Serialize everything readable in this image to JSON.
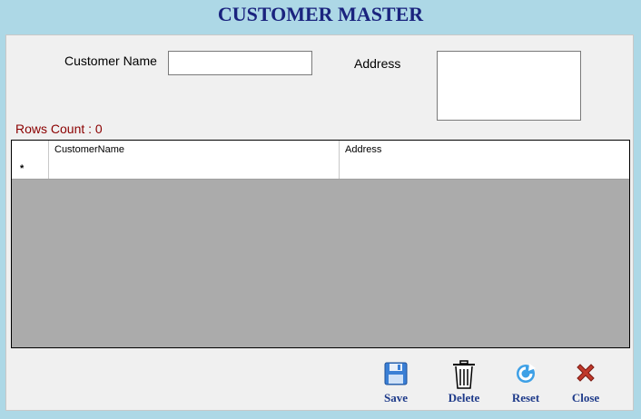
{
  "window": {
    "title": "CUSTOMER MASTER"
  },
  "form": {
    "customer_name_label": "Customer Name",
    "customer_name_value": "",
    "address_label": "Address",
    "address_value": "",
    "rows_count_text": "Rows Count : 0"
  },
  "grid": {
    "columns": [
      "CustomerName",
      "Address"
    ],
    "new_row_marker": "*",
    "rows": []
  },
  "toolbar": {
    "save_label": "Save",
    "delete_label": "Delete",
    "reset_label": "Reset",
    "close_label": "Close"
  },
  "colors": {
    "background": "#add8e6",
    "title": "#1a237e",
    "rows_count": "#8b0000",
    "grid_empty": "#ababab"
  }
}
